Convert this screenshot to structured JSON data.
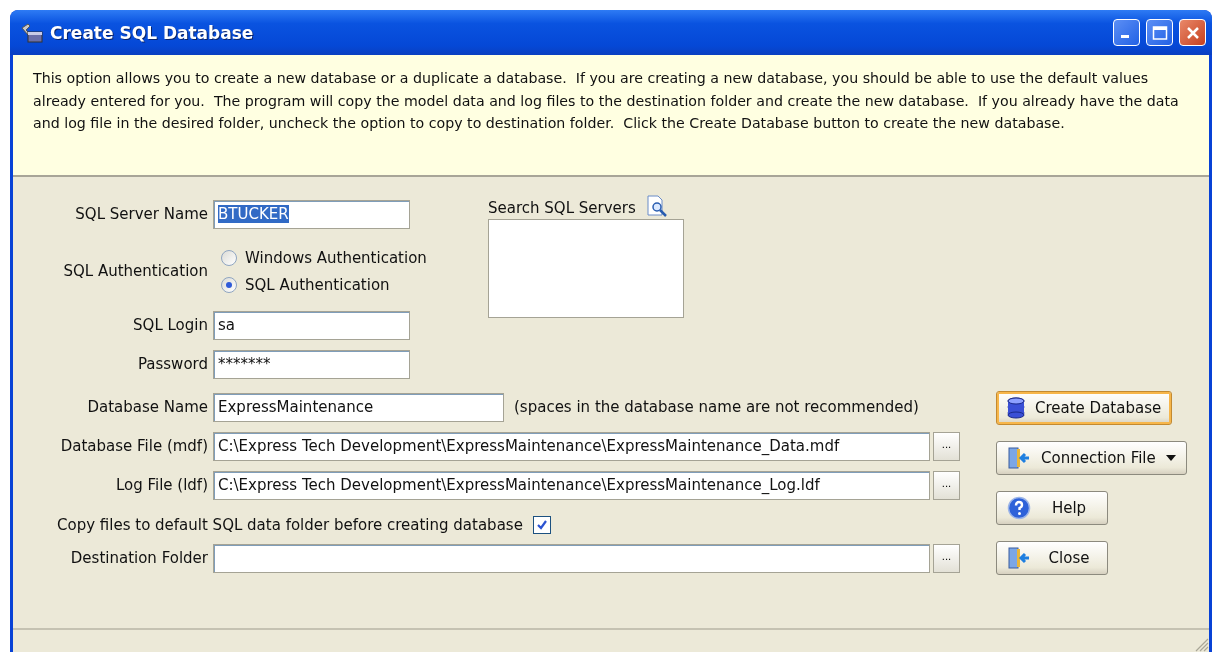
{
  "window": {
    "title": "Create SQL Database"
  },
  "info_text": "This option allows you to create a new database or a duplicate a database.  If you are creating a new database, you should be able to use the default values already entered for you.  The program will copy the model data and log files to the destination folder and create the new database.  If you already have the data and log file in the desired folder, uncheck the option to copy to destination folder.  Click the Create Database button to create the new database.",
  "server": {
    "label": "SQL Server Name",
    "value": "BTUCKER",
    "text_selected": true
  },
  "auth": {
    "label": "SQL Authentication",
    "options": [
      {
        "label": "Windows Authentication",
        "selected": false
      },
      {
        "label": "SQL Authentication",
        "selected": true
      }
    ]
  },
  "login": {
    "label": "SQL Login",
    "value": "sa"
  },
  "password": {
    "label": "Password",
    "value": "*******"
  },
  "search": {
    "label": "Search SQL Servers"
  },
  "database_name": {
    "label": "Database Name",
    "value": "ExpressMaintenance",
    "note": "(spaces in the database name are not recommended)"
  },
  "files": [
    {
      "label": "Database File (mdf)",
      "value": "C:\\Express Tech Development\\ExpressMaintenance\\ExpressMaintenance_Data.mdf",
      "browse": "..."
    },
    {
      "label": "Log File (ldf)",
      "value": "C:\\Express Tech Development\\ExpressMaintenance\\ExpressMaintenance_Log.ldf",
      "browse": "..."
    }
  ],
  "copy_files": {
    "label": "Copy files to default SQL data folder before creating database",
    "checked": true
  },
  "destination": {
    "label": "Destination Folder",
    "browse": "..."
  },
  "buttons": [
    {
      "label": "Create Database",
      "kind": "database",
      "hovered": true,
      "dropdown": false
    },
    {
      "label": "Connection File",
      "kind": "door",
      "hovered": false,
      "dropdown": true
    },
    {
      "label": "Help",
      "kind": "help",
      "hovered": false,
      "dropdown": false
    },
    {
      "label": "Close",
      "kind": "door",
      "hovered": false,
      "dropdown": false
    }
  ]
}
